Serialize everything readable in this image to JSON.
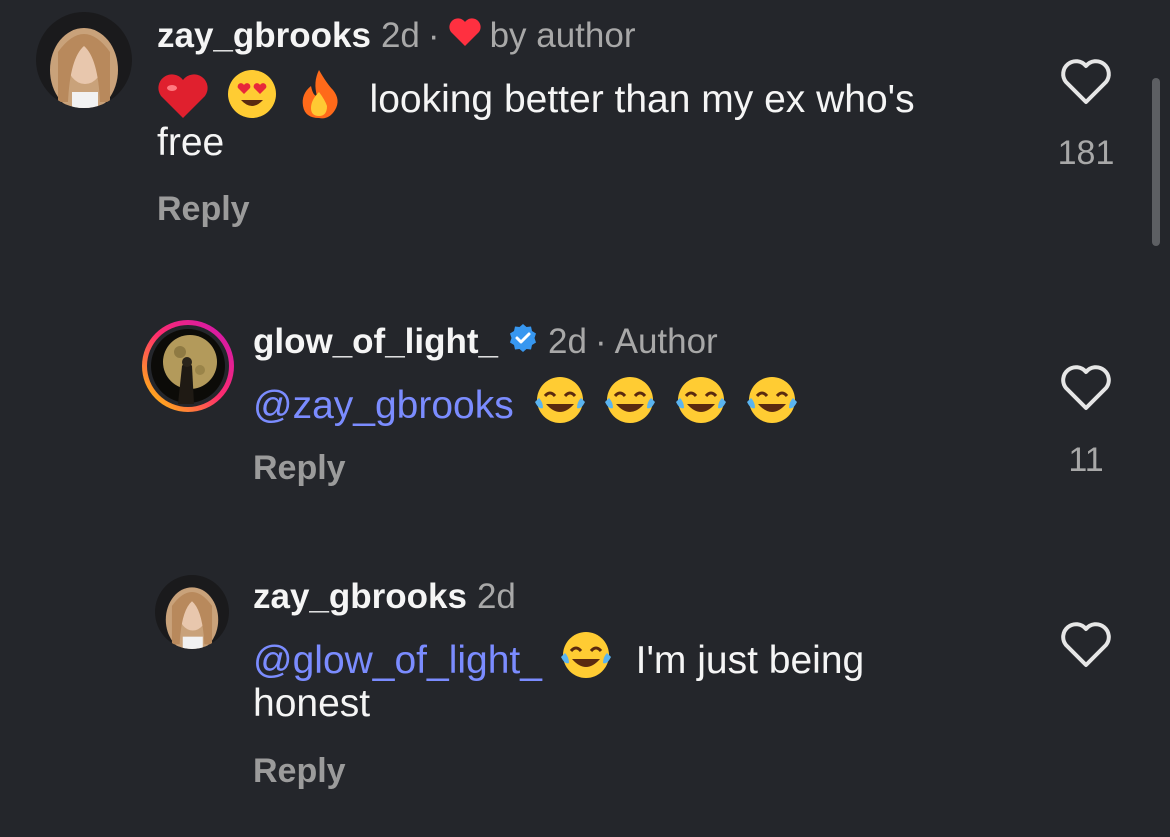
{
  "comments": [
    {
      "username": "zay_gbrooks",
      "time": "2d",
      "badge_label": "by author",
      "emojis": [
        "heart-emoji",
        "heart-eyes-emoji",
        "fire-emoji"
      ],
      "text": "looking better than my ex who's",
      "text_line2": "free",
      "reply_label": "Reply",
      "likes": "181"
    },
    {
      "username": "glow_of_light_",
      "verified": true,
      "time": "2d",
      "badge_label": "Author",
      "mention": "@zay_gbrooks",
      "emojis": [
        "tears-of-joy-emoji",
        "tears-of-joy-emoji",
        "tears-of-joy-emoji",
        "tears-of-joy-emoji"
      ],
      "reply_label": "Reply",
      "likes": "11"
    },
    {
      "username": "zay_gbrooks",
      "time": "2d",
      "mention": "@glow_of_light_",
      "emojis": [
        "tears-of-joy-emoji"
      ],
      "text": "I'm just being",
      "text_line2": "honest",
      "reply_label": "Reply"
    }
  ],
  "separator": "·",
  "colors": {
    "background": "#24262b",
    "mention": "#7b8cff",
    "verified": "#3797f0",
    "heart": "#ff3040",
    "muted": "#a8a8a8"
  }
}
